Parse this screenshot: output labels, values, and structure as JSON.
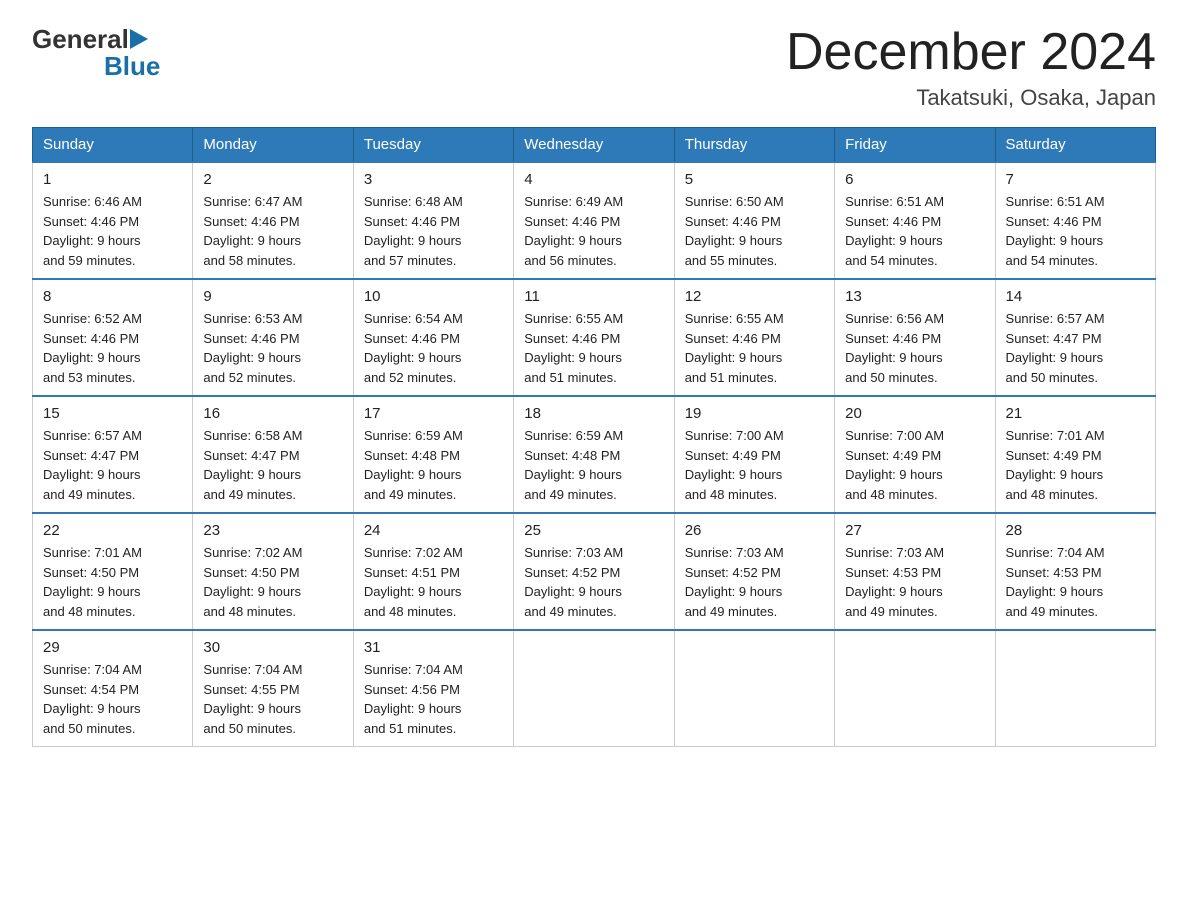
{
  "header": {
    "logo_general": "General",
    "logo_blue": "Blue",
    "month_title": "December 2024",
    "location": "Takatsuki, Osaka, Japan"
  },
  "days_of_week": [
    "Sunday",
    "Monday",
    "Tuesday",
    "Wednesday",
    "Thursday",
    "Friday",
    "Saturday"
  ],
  "weeks": [
    [
      {
        "day": "1",
        "sunrise": "6:46 AM",
        "sunset": "4:46 PM",
        "daylight": "9 hours and 59 minutes."
      },
      {
        "day": "2",
        "sunrise": "6:47 AM",
        "sunset": "4:46 PM",
        "daylight": "9 hours and 58 minutes."
      },
      {
        "day": "3",
        "sunrise": "6:48 AM",
        "sunset": "4:46 PM",
        "daylight": "9 hours and 57 minutes."
      },
      {
        "day": "4",
        "sunrise": "6:49 AM",
        "sunset": "4:46 PM",
        "daylight": "9 hours and 56 minutes."
      },
      {
        "day": "5",
        "sunrise": "6:50 AM",
        "sunset": "4:46 PM",
        "daylight": "9 hours and 55 minutes."
      },
      {
        "day": "6",
        "sunrise": "6:51 AM",
        "sunset": "4:46 PM",
        "daylight": "9 hours and 54 minutes."
      },
      {
        "day": "7",
        "sunrise": "6:51 AM",
        "sunset": "4:46 PM",
        "daylight": "9 hours and 54 minutes."
      }
    ],
    [
      {
        "day": "8",
        "sunrise": "6:52 AM",
        "sunset": "4:46 PM",
        "daylight": "9 hours and 53 minutes."
      },
      {
        "day": "9",
        "sunrise": "6:53 AM",
        "sunset": "4:46 PM",
        "daylight": "9 hours and 52 minutes."
      },
      {
        "day": "10",
        "sunrise": "6:54 AM",
        "sunset": "4:46 PM",
        "daylight": "9 hours and 52 minutes."
      },
      {
        "day": "11",
        "sunrise": "6:55 AM",
        "sunset": "4:46 PM",
        "daylight": "9 hours and 51 minutes."
      },
      {
        "day": "12",
        "sunrise": "6:55 AM",
        "sunset": "4:46 PM",
        "daylight": "9 hours and 51 minutes."
      },
      {
        "day": "13",
        "sunrise": "6:56 AM",
        "sunset": "4:46 PM",
        "daylight": "9 hours and 50 minutes."
      },
      {
        "day": "14",
        "sunrise": "6:57 AM",
        "sunset": "4:47 PM",
        "daylight": "9 hours and 50 minutes."
      }
    ],
    [
      {
        "day": "15",
        "sunrise": "6:57 AM",
        "sunset": "4:47 PM",
        "daylight": "9 hours and 49 minutes."
      },
      {
        "day": "16",
        "sunrise": "6:58 AM",
        "sunset": "4:47 PM",
        "daylight": "9 hours and 49 minutes."
      },
      {
        "day": "17",
        "sunrise": "6:59 AM",
        "sunset": "4:48 PM",
        "daylight": "9 hours and 49 minutes."
      },
      {
        "day": "18",
        "sunrise": "6:59 AM",
        "sunset": "4:48 PM",
        "daylight": "9 hours and 49 minutes."
      },
      {
        "day": "19",
        "sunrise": "7:00 AM",
        "sunset": "4:49 PM",
        "daylight": "9 hours and 48 minutes."
      },
      {
        "day": "20",
        "sunrise": "7:00 AM",
        "sunset": "4:49 PM",
        "daylight": "9 hours and 48 minutes."
      },
      {
        "day": "21",
        "sunrise": "7:01 AM",
        "sunset": "4:49 PM",
        "daylight": "9 hours and 48 minutes."
      }
    ],
    [
      {
        "day": "22",
        "sunrise": "7:01 AM",
        "sunset": "4:50 PM",
        "daylight": "9 hours and 48 minutes."
      },
      {
        "day": "23",
        "sunrise": "7:02 AM",
        "sunset": "4:50 PM",
        "daylight": "9 hours and 48 minutes."
      },
      {
        "day": "24",
        "sunrise": "7:02 AM",
        "sunset": "4:51 PM",
        "daylight": "9 hours and 48 minutes."
      },
      {
        "day": "25",
        "sunrise": "7:03 AM",
        "sunset": "4:52 PM",
        "daylight": "9 hours and 49 minutes."
      },
      {
        "day": "26",
        "sunrise": "7:03 AM",
        "sunset": "4:52 PM",
        "daylight": "9 hours and 49 minutes."
      },
      {
        "day": "27",
        "sunrise": "7:03 AM",
        "sunset": "4:53 PM",
        "daylight": "9 hours and 49 minutes."
      },
      {
        "day": "28",
        "sunrise": "7:04 AM",
        "sunset": "4:53 PM",
        "daylight": "9 hours and 49 minutes."
      }
    ],
    [
      {
        "day": "29",
        "sunrise": "7:04 AM",
        "sunset": "4:54 PM",
        "daylight": "9 hours and 50 minutes."
      },
      {
        "day": "30",
        "sunrise": "7:04 AM",
        "sunset": "4:55 PM",
        "daylight": "9 hours and 50 minutes."
      },
      {
        "day": "31",
        "sunrise": "7:04 AM",
        "sunset": "4:56 PM",
        "daylight": "9 hours and 51 minutes."
      },
      null,
      null,
      null,
      null
    ]
  ],
  "labels": {
    "sunrise": "Sunrise:",
    "sunset": "Sunset:",
    "daylight": "Daylight:"
  }
}
